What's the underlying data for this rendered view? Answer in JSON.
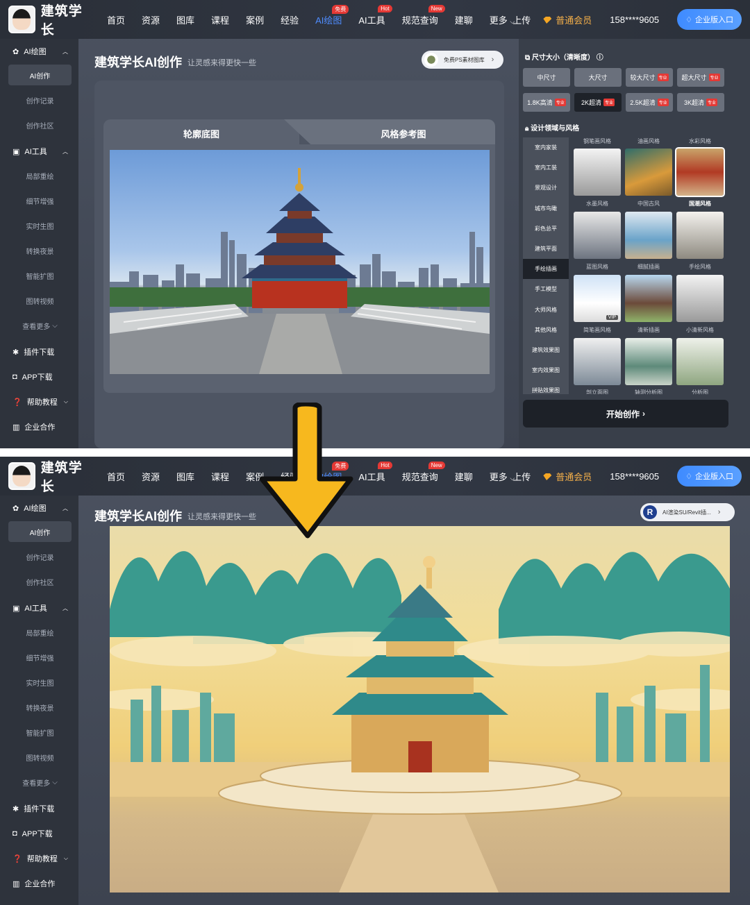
{
  "header": {
    "logo_text": "建筑学长",
    "nav": [
      {
        "label": "首页",
        "active": false,
        "badge": ""
      },
      {
        "label": "资源",
        "active": false,
        "badge": ""
      },
      {
        "label": "图库",
        "active": false,
        "badge": ""
      },
      {
        "label": "课程",
        "active": false,
        "badge": ""
      },
      {
        "label": "案例",
        "active": false,
        "badge": ""
      },
      {
        "label": "经验",
        "active": false,
        "badge": ""
      },
      {
        "label": "AI绘图",
        "active": true,
        "badge": "免费"
      },
      {
        "label": "AI工具",
        "active": false,
        "badge": "Hot"
      },
      {
        "label": "规范查询",
        "active": false,
        "badge": "New"
      },
      {
        "label": "建聊",
        "active": false,
        "badge": ""
      },
      {
        "label": "更多",
        "active": false,
        "badge": ""
      }
    ],
    "upload": "上传",
    "member": "普通会员",
    "phone": "158****9605",
    "enterprise": "企业版入口"
  },
  "sidebar": {
    "group1": "AI绘图",
    "group1_items": [
      "AI创作",
      "创作记录",
      "创作社区"
    ],
    "group2": "AI工具",
    "group2_items": [
      "局部重绘",
      "细节增强",
      "实时生图",
      "转换夜景",
      "智能扩图",
      "图转视频",
      "查看更多"
    ],
    "links": [
      "插件下载",
      "APP下载",
      "帮助教程",
      "企业合作"
    ]
  },
  "main": {
    "title": "建筑学长AI创作",
    "subtitle": "让灵感来得更快一些",
    "promo1": "免费PS素材图库",
    "promo2": "AI渲染SU/Revit插...",
    "tab_outline": "轮廓底图",
    "tab_style": "风格参考图"
  },
  "right": {
    "size_title": "尺寸大小（清晰度）",
    "sizes": [
      "中尺寸",
      "大尺寸",
      "较大尺寸",
      "超大尺寸"
    ],
    "sizes_vip": [
      false,
      false,
      true,
      true
    ],
    "res": [
      "1.8K高清",
      "2K超清",
      "2.5K超清",
      "3K超清"
    ],
    "res_tag": "专业",
    "selected_res": "2K超清",
    "domain_title": "设计领域与风格",
    "domains": [
      "室内家装",
      "室内工装",
      "景观设计",
      "城市鸟瞰",
      "彩色总平",
      "建筑平面",
      "手绘插画",
      "手工模型",
      "大师风格",
      "其他风格",
      "建筑效果图",
      "室内效果图",
      "拼贴效果图"
    ],
    "selected_domain": "手绘插画",
    "top_labels": [
      "钢笔画风格",
      "油画风格",
      "水彩风格"
    ],
    "styles": [
      "水墨风格",
      "中国古风",
      "国潮风格",
      "蓝图风格",
      "细腻插画",
      "手绘风格",
      "简笔画风格",
      "清新插画",
      "小清新风格",
      "剖立面图",
      "轴测分析图",
      "分析图"
    ],
    "selected_style": "国潮风格",
    "vip_tag": "VIP",
    "start_button": "开始创作"
  },
  "colors": {
    "accent": "#4f8dff",
    "badge_free": "#e53935",
    "badge_hot": "#e53935",
    "badge_new": "#e53935",
    "member_gold": "#f5b04a",
    "arrow": "#f7b81e"
  }
}
